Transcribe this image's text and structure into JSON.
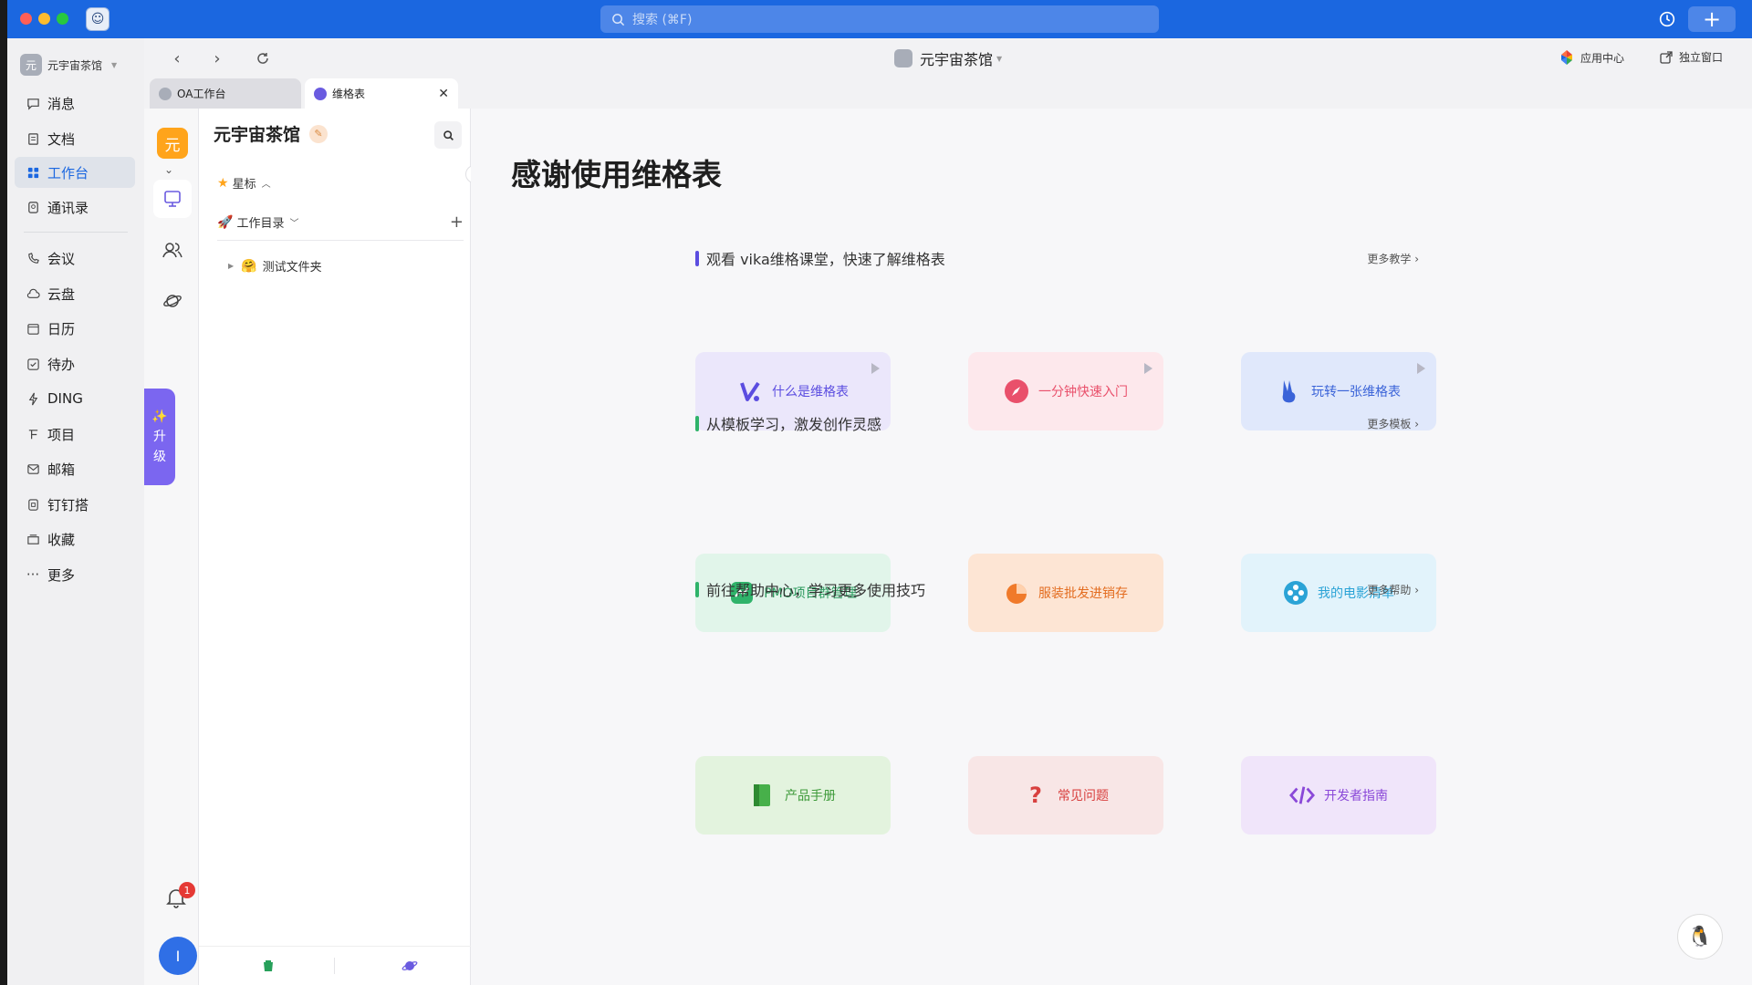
{
  "titlebar": {
    "search_placeholder": "搜索 (⌘F)"
  },
  "sidebar": {
    "org_name": "元宇宙茶馆",
    "org_initial": "元",
    "items": [
      {
        "label": "消息",
        "icon": "message-icon"
      },
      {
        "label": "文档",
        "icon": "document-icon"
      },
      {
        "label": "工作台",
        "icon": "workbench-icon",
        "active": true
      },
      {
        "label": "通讯录",
        "icon": "contacts-icon"
      },
      {
        "label": "会议",
        "icon": "meeting-icon"
      },
      {
        "label": "云盘",
        "icon": "cloud-drive-icon"
      },
      {
        "label": "日历",
        "icon": "calendar-icon"
      },
      {
        "label": "待办",
        "icon": "todo-icon"
      },
      {
        "label": "DING",
        "icon": "ding-icon"
      },
      {
        "label": "项目",
        "icon": "project-icon"
      },
      {
        "label": "邮箱",
        "icon": "mail-icon"
      },
      {
        "label": "钉钉搭",
        "icon": "lowcode-icon"
      },
      {
        "label": "收藏",
        "icon": "favorite-icon"
      },
      {
        "label": "更多",
        "icon": "more-icon"
      }
    ]
  },
  "header": {
    "center_title": "元宇宙茶馆",
    "app_center": "应用中心",
    "standalone": "独立窗口"
  },
  "tabs": [
    {
      "label": "OA工作台"
    },
    {
      "label": "维格表",
      "close": "✕"
    }
  ],
  "rail": {
    "space_initial": "元",
    "upgrade_line1": "升",
    "upgrade_line2": "级",
    "notification_count": "1",
    "user_initial": "I"
  },
  "catalog": {
    "title": "元宇宙茶馆",
    "starred_label": "星标",
    "workdir_label": "工作目录",
    "add": "+",
    "folder_name": "测试文件夹"
  },
  "main": {
    "headline": "感谢使用维格表",
    "sections": [
      {
        "title": "观看 vika维格课堂，快速了解维格表",
        "more": "更多教学",
        "accent": "#5b4de0",
        "cards": [
          {
            "label": "什么是维格表",
            "bg": "#ebe7fb",
            "fg": "#5b4de0",
            "icon": "vika-logo-icon"
          },
          {
            "label": "一分钟快速入门",
            "bg": "#fde8ec",
            "fg": "#e9506b",
            "icon": "compass-icon"
          },
          {
            "label": "玩转一张维格表",
            "bg": "#e0e8fb",
            "fg": "#3a63d8",
            "icon": "victory-hand-icon"
          }
        ]
      },
      {
        "title": "从模板学习，激发创作灵感",
        "more": "更多模板",
        "accent": "#2fb36a",
        "cards": [
          {
            "label": "PMO项目群管理",
            "bg": "#e1f5ea",
            "fg": "#2e9a5f",
            "icon": "trend-chart-icon"
          },
          {
            "label": "服装批发进销存",
            "bg": "#fde5d4",
            "fg": "#e36c1f",
            "icon": "pie-chart-icon"
          },
          {
            "label": "我的电影清单",
            "bg": "#e2f3fb",
            "fg": "#2ba3d6",
            "icon": "film-reel-icon"
          }
        ]
      },
      {
        "title": "前往帮助中心，学习更多使用技巧",
        "more": "更多帮助",
        "accent": "#2fb36a",
        "cards": [
          {
            "label": "产品手册",
            "bg": "#e3f3de",
            "fg": "#3e9a3a",
            "icon": "book-icon"
          },
          {
            "label": "常见问题",
            "bg": "#f8e6e6",
            "fg": "#d8403f",
            "icon": "question-icon"
          },
          {
            "label": "开发者指南",
            "bg": "#f0e5fa",
            "fg": "#8a48d8",
            "icon": "code-icon"
          }
        ]
      }
    ]
  },
  "colors": {
    "brand_blue": "#1b67e0",
    "vika_purple": "#7b66f0",
    "space_orange": "#ffa41b"
  }
}
